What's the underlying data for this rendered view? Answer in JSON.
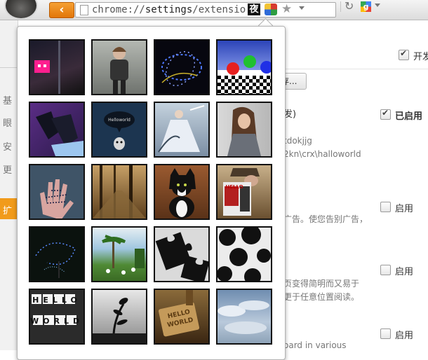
{
  "toolbar": {
    "back_glyph": "‹",
    "url_prefix": "chrome://",
    "url_host": "settings",
    "url_path": "/extensior",
    "ext1_char": "夜",
    "star_glyph": "★",
    "reload_glyph": "↻",
    "google_letter": "g"
  },
  "settings": {
    "nav_chars": [
      "基",
      "眼",
      "安",
      "更",
      "扩"
    ],
    "dev_mode_label": "开发",
    "button_fragment": "存...",
    "ext_title_fragment": "发)",
    "enabled_label": "已启用",
    "id_fragment": "tdokjjg",
    "path_fragment": "2kn\\crx\\halloworld",
    "enable_label": "启用",
    "desc1": "广告。使您告别广告，",
    "desc2_line1": "页变得简明而又易于",
    "desc2_line2": "更于任意位置阅读。",
    "desc3": "oard in various"
  },
  "thumb_text": {
    "speech_bubble": "Helloworld",
    "magazine_title": "HELLO",
    "keyboard_word1": "HELLO",
    "keyboard_word2": "WORLD",
    "stamp_line1": "HELLO",
    "stamp_line2": "WORLD"
  },
  "popup": {
    "thumbnails": [
      {
        "name": "pink-robot",
        "bg": "#3a2b3a"
      },
      {
        "name": "boy-portrait",
        "bg": "#8a8f8a"
      },
      {
        "name": "light-swirl",
        "bg": "#0a0a12"
      },
      {
        "name": "rgb-spheres",
        "bg": "#5b6fd1"
      },
      {
        "name": "boots",
        "bg": "#3d2a66"
      },
      {
        "name": "speech-bubble-bird",
        "bg": "#1f3a55"
      },
      {
        "name": "bride-fantasy",
        "bg": "#9fb0c2"
      },
      {
        "name": "girl-portrait",
        "bg": "#c9c9c9"
      },
      {
        "name": "hand-writing",
        "bg": "#4a5f73"
      },
      {
        "name": "forest-path",
        "bg": "#7a5b2e"
      },
      {
        "name": "black-white-cat",
        "bg": "#8a4b2a"
      },
      {
        "name": "magazine-reader",
        "bg": "#a48a5c"
      },
      {
        "name": "light-trails",
        "bg": "#0c1410"
      },
      {
        "name": "palm-trees",
        "bg": "#6aa14a"
      },
      {
        "name": "puzzle-pieces",
        "bg": "#d8d8d8"
      },
      {
        "name": "polka-dots",
        "bg": "#e9e9e9"
      },
      {
        "name": "keyboard-hello",
        "bg": "#3a3a3a"
      },
      {
        "name": "plant-silhouette",
        "bg": "#b9b9b9"
      },
      {
        "name": "hello-world-stamp",
        "bg": "#6a4a22"
      },
      {
        "name": "cloudy-sky",
        "bg": "#7e9bb9"
      }
    ]
  }
}
